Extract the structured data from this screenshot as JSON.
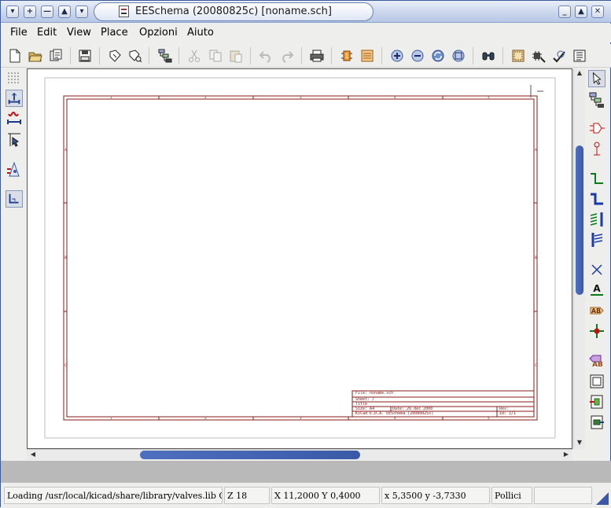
{
  "window": {
    "title": "EESchema (20080825c) [noname.sch]",
    "buttons": {
      "menu": "▾",
      "add": "+",
      "minimize_left": "—",
      "maximize_left": "▲",
      "shade": "▾",
      "minimize": "_",
      "maximize": "▲",
      "close": "✕"
    }
  },
  "menubar": {
    "items": [
      {
        "label": "File"
      },
      {
        "label": "Edit"
      },
      {
        "label": "View"
      },
      {
        "label": "Place"
      },
      {
        "label": "Opzioni"
      },
      {
        "label": "Aiuto"
      }
    ]
  },
  "toolbar": {
    "icons": [
      "new-icon",
      "open-icon",
      "load-project-icon",
      "save-icon",
      "library-editor-icon",
      "library-browser-icon",
      "hierarchy-icon",
      "cut-icon",
      "copy-icon",
      "paste-icon",
      "undo-icon",
      "redo-icon",
      "print-icon",
      "annotate-icon",
      "erc-icon",
      "zoom-in-icon",
      "zoom-out-icon",
      "redraw-icon",
      "zoom-fit-icon",
      "find-icon",
      "netlist-icon",
      "cvpcb-icon",
      "bom-icon",
      "pcbnew-icon"
    ]
  },
  "left_toolbar": {
    "icons": [
      "grid-icon",
      "units-inch-icon",
      "units-mm-icon",
      "cursor-shape-icon",
      "hidden-pins-icon",
      "bus-wire-orient-icon"
    ]
  },
  "right_toolbar": {
    "icons": [
      "select-arrow-icon",
      "hierarchy-navigate-icon",
      "add-component-icon",
      "add-power-icon",
      "add-wire-icon",
      "add-bus-icon",
      "wire-to-bus-entry-icon",
      "bus-to-bus-entry-icon",
      "no-connect-icon",
      "add-net-label-icon",
      "add-global-label-icon",
      "add-junction-icon",
      "add-hier-label-icon",
      "add-sheet-icon",
      "import-hier-label-icon",
      "add-hier-pin-icon"
    ]
  },
  "title_block": {
    "file_line": "File: noname.sch",
    "sheet_line": "Sheet: /",
    "title_line": "Title",
    "size_label": "Size: A4",
    "date_label": "Date: 26 dec 2008",
    "rev_label": "Rev:",
    "kicad_line": "KiCad E.D.A.   EESchema (20080825c)",
    "id_label": "Id: 1/1"
  },
  "statusbar": {
    "message": "Loading /usr/local/kicad/share/library/valves.lib OK",
    "zoom": "Z 18",
    "abs_coords": "X 11,2000  Y 0,4000",
    "rel_coords": "x 5,3500  y -3,7330",
    "units": "Pollici"
  },
  "colors": {
    "sheet_border": "#8b1a1a",
    "scroll_thumb": "#3a5aa8"
  }
}
